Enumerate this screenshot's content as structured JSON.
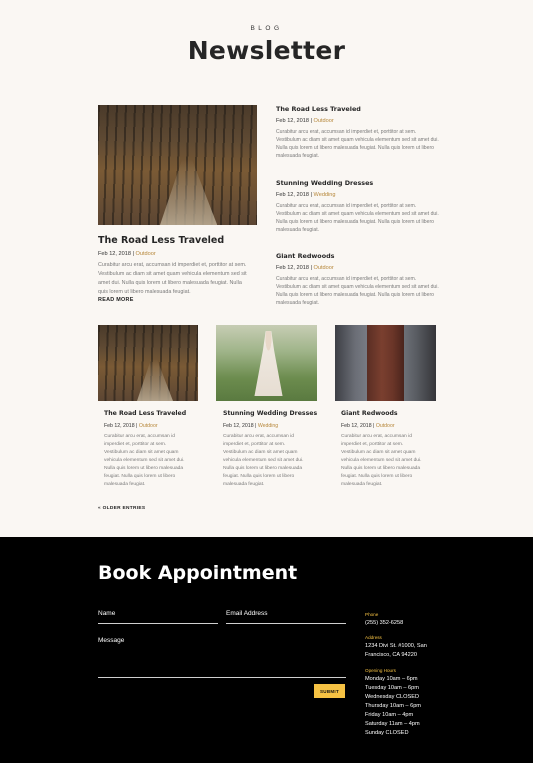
{
  "header": {
    "eyebrow": "BLOG",
    "title": "Newsletter"
  },
  "excerpt_line1": "Curabitur arcu erat, accumsan id imperdiet et, porttitor at sem.",
  "excerpt_line2": "Vestibulum ac diam sit amet quam vehicula elementum sed sit amet dui.",
  "excerpt_line3": "Nulla quis lorem ut libero malesuada feugiat.",
  "featured": {
    "title": "The Road Less Traveled",
    "date": "Feb 12, 2018",
    "category": "Outdoor",
    "lines": [
      "Curabitur arcu erat, accumsan id imperdiet et, porttitor at sem.",
      "Vestibulum ac diam sit amet quam vehicula elementum sed sit",
      "amet dui. Nulla quis lorem ut libero malesuada feugiat. Nulla",
      "quis lorem ut libero malesuada feugiat."
    ],
    "read_more": "READ MORE"
  },
  "side_posts": [
    {
      "title": "The Road Less Traveled",
      "date": "Feb 12, 2018",
      "category": "Outdoor",
      "lines": [
        "Curabitur arcu erat, accumsan id imperdiet et, porttitor at sem.",
        "Vestibulum ac diam sit amet quam vehicula elementum sed sit amet dui.",
        "Nulla quis lorem ut libero malesuada feugiat. Nulla quis lorem ut libero",
        "malesuada feugiat."
      ]
    },
    {
      "title": "Stunning Wedding Dresses",
      "date": "Feb 12, 2018",
      "category": "Wedding",
      "lines": [
        "Curabitur arcu erat, accumsan id imperdiet et, porttitor at sem.",
        "Vestibulum ac diam sit amet quam vehicula elementum sed sit amet dui.",
        "Nulla quis lorem ut libero malesuada feugiat. Nulla quis lorem ut libero",
        "malesuada feugiat."
      ]
    },
    {
      "title": "Giant Redwoods",
      "date": "Feb 12, 2018",
      "category": "Outdoor",
      "lines": [
        "Curabitur arcu erat, accumsan id imperdiet et, porttitor at sem.",
        "Vestibulum ac diam sit amet quam vehicula elementum sed sit amet dui.",
        "Nulla quis lorem ut libero malesuada feugiat. Nulla quis lorem ut libero",
        "malesuada feugiat."
      ]
    }
  ],
  "cards": [
    {
      "title": "The Road Less Traveled",
      "date": "Feb 12, 2018",
      "category": "Outdoor",
      "lines": [
        "Curabitur arcu erat, accumsan id",
        "imperdiet et, porttitor at sem.",
        "Vestibulum ac diam sit amet quam",
        "vehicula elementum sed sit amet dui.",
        "Nulla quis lorem ut libero malesuada",
        "feugiat. Nulla quis lorem ut libero",
        "malesuada feugiat."
      ]
    },
    {
      "title": "Stunning Wedding Dresses",
      "date": "Feb 12, 2018",
      "category": "Wedding",
      "lines": [
        "Curabitur arcu erat, accumsan id",
        "imperdiet et, porttitor at sem.",
        "Vestibulum ac diam sit amet quam",
        "vehicula elementum sed sit amet dui.",
        "Nulla quis lorem ut libero malesuada",
        "feugiat. Nulla quis lorem ut libero",
        "malesuada feugiat."
      ]
    },
    {
      "title": "Giant Redwoods",
      "date": "Feb 12, 2018",
      "category": "Outdoor",
      "lines": [
        "Curabitur arcu erat, accumsan id",
        "imperdiet et, porttitor at sem.",
        "Vestibulum ac diam sit amet quam",
        "vehicula elementum sed sit amet dui.",
        "Nulla quis lorem ut libero malesuada",
        "feugiat. Nulla quis lorem ut libero",
        "malesuada feugiat."
      ]
    }
  ],
  "pagination": {
    "older": "« OLDER ENTRIES"
  },
  "appointment": {
    "title": "Book Appointment",
    "name_label": "Name",
    "email_label": "Email Address",
    "message_label": "Message",
    "submit_label": "SUBMIT"
  },
  "contact": {
    "phone_label": "Phone",
    "phone": "(255) 352-6258",
    "address_label": "Address",
    "address_lines": [
      "1234 Divi St. #1000, San",
      "Francisco, CA 94220"
    ],
    "hours_label": "Opening Hours",
    "hours": [
      "Monday 10am – 6pm",
      "Tuesday 10am – 6pm",
      "Wednesday CLOSED",
      "Thursday 10am – 6pm",
      "Friday 10am – 4pm",
      "Saturday 11am – 4pm",
      "Sunday CLOSED"
    ]
  },
  "colors": {
    "accent": "#f6c243",
    "category": "#b6873a",
    "background": "#faf7f3",
    "footer": "#000000"
  }
}
